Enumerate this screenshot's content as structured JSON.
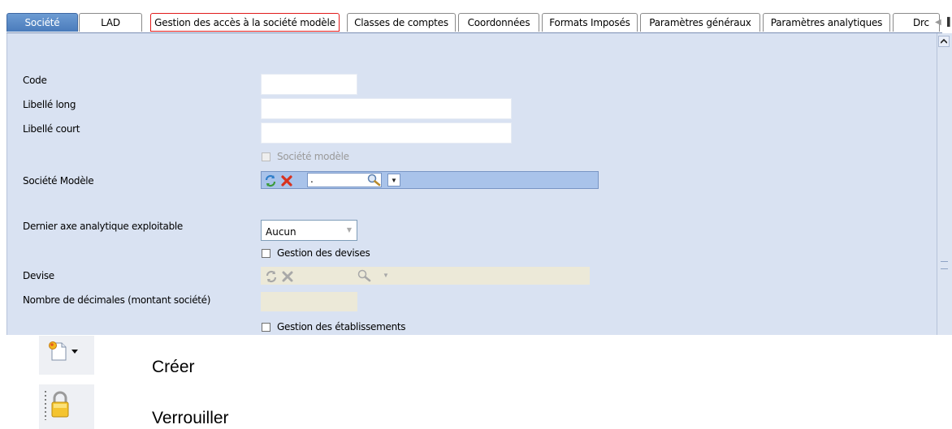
{
  "tabs": [
    {
      "label": "Société",
      "active": true
    },
    {
      "label": "LAD"
    },
    {
      "label": "Gestion des accès à la société modèle",
      "highlighted": true
    },
    {
      "label": "Classes de comptes"
    },
    {
      "label": "Coordonnées"
    },
    {
      "label": "Formats Imposés"
    },
    {
      "label": "Paramètres généraux"
    },
    {
      "label": "Paramètres analytiques"
    },
    {
      "label": "Drc"
    }
  ],
  "form": {
    "code_label": "Code",
    "code_value": "",
    "libelle_long_label": "Libellé long",
    "libelle_long_value": "",
    "libelle_court_label": "Libellé court",
    "libelle_court_value": "",
    "societe_modele_checkbox_label": "Société modèle",
    "societe_modele_label": "Société Modèle",
    "societe_modele_value": ".",
    "dernier_axe_label": "Dernier axe analytique exploitable",
    "dernier_axe_value": "Aucun",
    "gestion_devises_label": "Gestion des devises",
    "devise_label": "Devise",
    "nb_decimales_label": "Nombre de décimales (montant société)",
    "gestion_etablissements_label": "Gestion des établissements"
  },
  "legend": [
    {
      "icon": "new-document-icon",
      "label": "Créer"
    },
    {
      "icon": "padlock-icon",
      "label": "Verrouiller"
    }
  ],
  "colors": {
    "panel": "#d9e2f2",
    "active_tab": "#4a7bbb",
    "highlight": "#e01b1b"
  }
}
